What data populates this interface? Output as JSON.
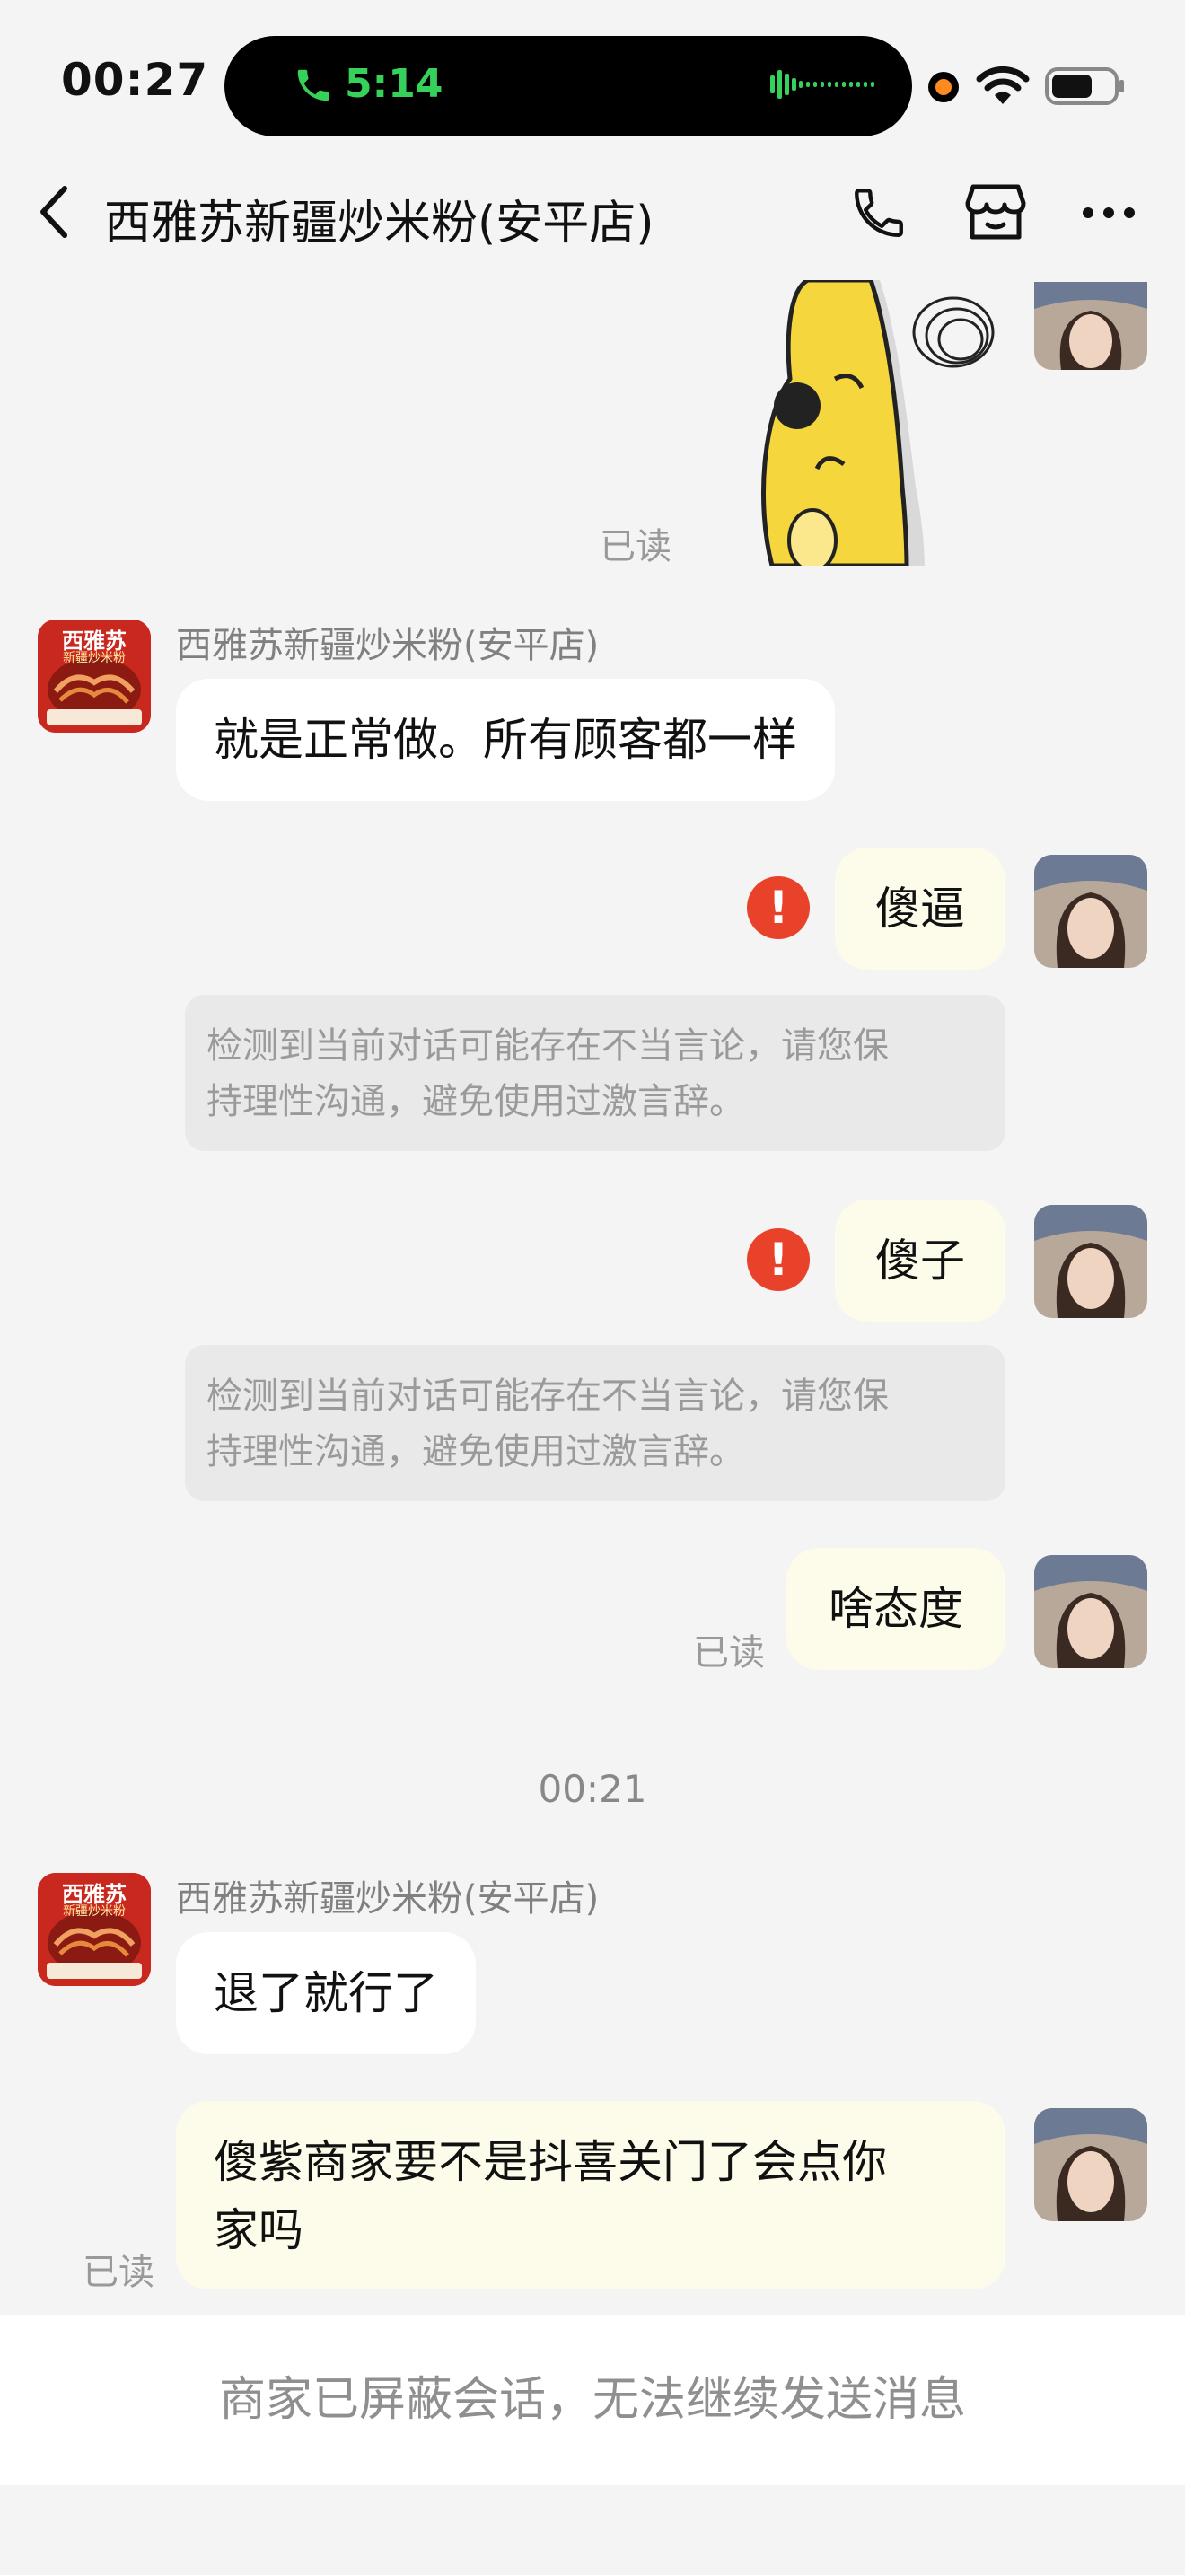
{
  "status_bar": {
    "time": "00:27",
    "call_time": "5:14"
  },
  "nav": {
    "title": "西雅苏新疆炒米粉(安平店)"
  },
  "merchant_avatar": {
    "brand": "西雅苏",
    "tagline": "新疆炒米粉"
  },
  "messages": {
    "read_label": "已读",
    "merchant_name": "西雅苏新疆炒米粉(安平店)",
    "m1": "就是正常做。所有顾客都一样",
    "u1": "傻逼",
    "warn1_line1": "检测到当前对话可能存在不当言论，请您保",
    "warn1_line2": "持理性沟通，避免使用过激言辞。",
    "u2": "傻子",
    "warn2_line1": "检测到当前对话可能存在不当言论，请您保",
    "warn2_line2": "持理性沟通，避免使用过激言辞。",
    "u3": "啥态度",
    "time_sep": "00:21",
    "m2": "退了就行了",
    "u4_line1": "傻紫商家要不是抖喜关门了会点你",
    "u4_line2": "家吗",
    "error_mark": "!"
  },
  "footer": {
    "blocked_text": "商家已屏蔽会话，无法继续发送消息"
  },
  "colors": {
    "background": "#f4f4f4",
    "user_bubble": "#fdfbe9",
    "merchant_bubble": "#ffffff",
    "warning_bg": "#e9e9e9",
    "error_red": "#e8432a",
    "call_green": "#35d15a"
  }
}
